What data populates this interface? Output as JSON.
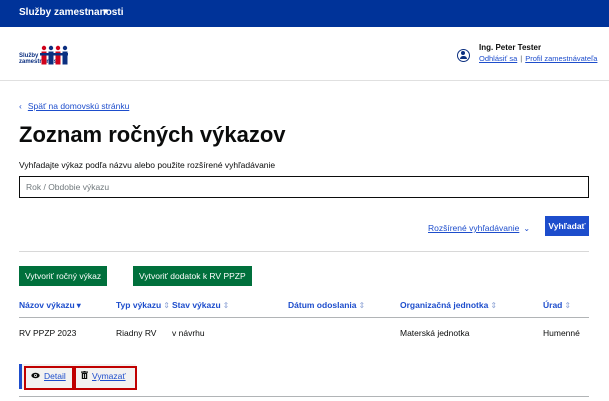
{
  "topbar": {
    "brand": "Služby zamestnanosti",
    "caret": "▾"
  },
  "logo": {
    "line1": "Služby",
    "line2": "zamestnanosti"
  },
  "user": {
    "name": "Ing. Peter Tester",
    "logout": "Odhlásiť sa",
    "separator": "|",
    "profile": "Profil zamestnávateľa"
  },
  "nav": {
    "back_label": "Späť na domovskú stránku",
    "back_chevron": "‹"
  },
  "page": {
    "title": "Zoznam ročných výkazov",
    "hint": "Vyhľadajte výkaz podľa názvu alebo použite rozšírené vyhľadávanie"
  },
  "search": {
    "placeholder": "Rok / Obdobie výkazu",
    "value": "",
    "advanced_label": "Rozšírené vyhľadávanie",
    "advanced_chevron": "⌄",
    "button_label": "Vyhľadať"
  },
  "buttons": {
    "create_report": "Vytvoriť ročný výkaz",
    "create_addendum": "Vytvoriť dodatok k RV PPZP"
  },
  "table": {
    "columns": [
      {
        "label": "Názov výkazu",
        "sort": "▾"
      },
      {
        "label": "Typ výkazu",
        "sort": "⇕"
      },
      {
        "label": "Stav výkazu",
        "sort": "⇕"
      },
      {
        "label": "Dátum odoslania",
        "sort": "⇕"
      },
      {
        "label": "Organizačná jednotka",
        "sort": "⇕"
      },
      {
        "label": "Úrad",
        "sort": "⇕"
      }
    ],
    "rows": [
      {
        "name": "RV PPZP 2023",
        "type": "Riadny RV",
        "status": "v návrhu",
        "sent_date": "",
        "org_unit": "Materská jednotka",
        "office": "Humenné"
      }
    ]
  },
  "row_actions": {
    "detail": "Detail",
    "delete": "Vymazať",
    "detail_icon": "eye-icon",
    "delete_icon": "trash-icon"
  },
  "colors": {
    "topbar": "#003399",
    "link": "#1d4dcc",
    "primary_button": "#1d4dcc",
    "green_button": "#00703c",
    "highlight_box": "#c00000"
  }
}
